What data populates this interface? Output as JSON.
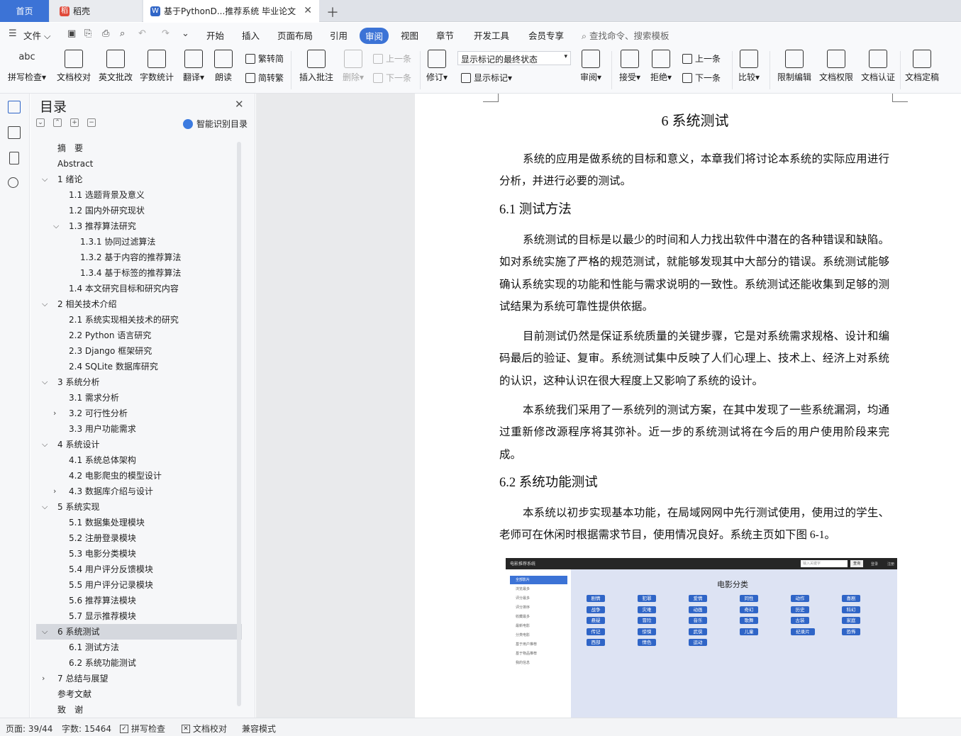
{
  "tabs": {
    "home": "首页",
    "daoke": "稻壳",
    "doc": "基于PythonD...推荐系统 毕业论文"
  },
  "menu": {
    "file": "文件",
    "items": [
      "开始",
      "插入",
      "页面布局",
      "引用",
      "审阅",
      "视图",
      "章节",
      "开发工具",
      "会员专享"
    ],
    "active": "审阅",
    "search": "查找命令、搜索模板"
  },
  "ribbon": {
    "spell": "拼写检查",
    "doc_check": "文档校对",
    "en_review": "英文批改",
    "word_count": "字数统计",
    "translate": "翻译",
    "read_aloud": "朗读",
    "trad_simp": "繁转简",
    "simp_trad": "简转繁",
    "insert_comment": "插入批注",
    "delete": "删除",
    "prev": "上一条",
    "next": "下一条",
    "revise": "修订",
    "markup_select": "显示标记的最终状态",
    "show_markup": "显示标记",
    "review": "审阅",
    "accept": "接受",
    "reject": "拒绝",
    "prev2": "上一条",
    "next2": "下一条",
    "compare": "比较",
    "restrict": "限制编辑",
    "permission": "文档权限",
    "certify": "文档认证",
    "finalize": "文档定稿",
    "icon_abc": "abc"
  },
  "toc": {
    "title": "目录",
    "smart": "智能识别目录",
    "items": [
      {
        "label": "摘　要"
      },
      {
        "label": "Abstract"
      },
      {
        "label": "1 绪论"
      },
      {
        "label": "1.1 选题背景及意义"
      },
      {
        "label": "1.2 国内外研究现状"
      },
      {
        "label": "1.3 推荐算法研究"
      },
      {
        "label": "1.3.1 协同过滤算法"
      },
      {
        "label": "1.3.2 基于内容的推荐算法"
      },
      {
        "label": "1.3.4 基于标签的推荐算法"
      },
      {
        "label": "1.4 本文研究目标和研究内容"
      },
      {
        "label": "2 相关技术介绍"
      },
      {
        "label": "2.1 系统实现相关技术的研究"
      },
      {
        "label": "2.2 Python 语言研究"
      },
      {
        "label": "2.3 Django 框架研究"
      },
      {
        "label": "2.4 SQLite 数据库研究"
      },
      {
        "label": "3 系统分析"
      },
      {
        "label": "3.1 需求分析"
      },
      {
        "label": "3.2 可行性分析"
      },
      {
        "label": "3.3 用户功能需求"
      },
      {
        "label": "4 系统设计"
      },
      {
        "label": "4.1 系统总体架构"
      },
      {
        "label": "4.2 电影爬虫的模型设计"
      },
      {
        "label": "4.3 数据库介绍与设计"
      },
      {
        "label": "5 系统实现"
      },
      {
        "label": "5.1 数据集处理模块"
      },
      {
        "label": "5.2 注册登录模块"
      },
      {
        "label": "5.3 电影分类模块"
      },
      {
        "label": "5.4 用户评分反馈模块"
      },
      {
        "label": "5.5 用户评分记录模块"
      },
      {
        "label": "5.6 推荐算法模块"
      },
      {
        "label": "5.7 显示推荐模块"
      },
      {
        "label": "6 系统测试"
      },
      {
        "label": "6.1 测试方法"
      },
      {
        "label": "6.2 系统功能测试"
      },
      {
        "label": "7 总结与展望"
      },
      {
        "label": "参考文献"
      },
      {
        "label": "致　谢"
      }
    ]
  },
  "doc": {
    "h1": "6 系统测试",
    "p1": "系统的应用是做系统的目标和意义，本章我们将讨论本系统的实际应用进行分析，并进行必要的测试。",
    "h2a": "6.1 测试方法",
    "p2": "系统测试的目标是以最少的时间和人力找出软件中潜在的各种错误和缺陷。如对系统实施了严格的规范测试，就能够发现其中大部分的错误。系统测试能够确认系统实现的功能和性能与需求说明的一致性。系统测试还能收集到足够的测试结果为系统可靠性提供依据。",
    "p3": "目前测试仍然是保证系统质量的关键步骤，它是对系统需求规格、设计和编码最后的验证、复审。系统测试集中反映了人们心理上、技术上、经济上对系统的认识，这种认识在很大程度上又影响了系统的设计。",
    "p4": "本系统我们采用了一系统列的测试方案，在其中发现了一些系统漏洞，均通过重新修改源程序将其弥补。近一步的系统测试将在今后的用户使用阶段来完成。",
    "h2b": "6.2 系统功能测试",
    "p5": "本系统以初步实现基本功能，在局域网网中先行测试使用，使用过的学生、老师可在休闲时根据需求节目，使用情况良好。系统主页如下图 6-1。"
  },
  "figure": {
    "brand": "电影推荐系统",
    "search_placeholder": "输入关键字",
    "search_btn": "查询",
    "login": "登录",
    "register": "注册",
    "sidebar": [
      "全部影片",
      "浏览最多",
      "评分最多",
      "评分排序",
      "收藏最多",
      "最新电影",
      "分类电影",
      "基于用户推荐",
      "基于物品推荐",
      "我的信息"
    ],
    "title": "电影分类",
    "genres": [
      "剧情",
      "犯罪",
      "爱情",
      "同性",
      "动作",
      "喜剧",
      "战争",
      "灾难",
      "动画",
      "奇幻",
      "历史",
      "科幻",
      "悬疑",
      "冒险",
      "音乐",
      "歌舞",
      "古装",
      "家庭",
      "传记",
      "惊悚",
      "武侠",
      "儿童",
      "纪录片",
      "恐怖",
      "西部",
      "情色",
      "运动"
    ]
  },
  "status": {
    "page": "页面: 39/44",
    "words": "字数: 15464",
    "spell": "拼写检查",
    "check": "文档校对",
    "compat": "兼容模式"
  }
}
